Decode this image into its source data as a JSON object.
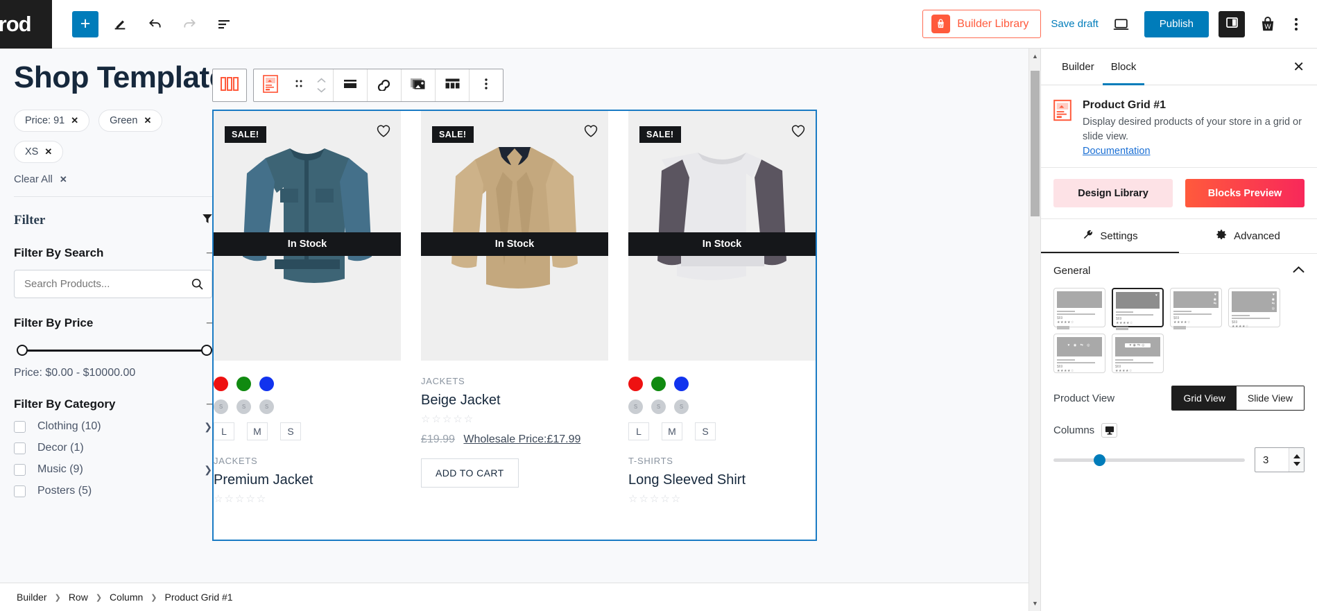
{
  "topbar": {
    "logo_text": "Prod",
    "add_label": "+",
    "icons": [
      "plus-icon",
      "pencil-icon",
      "undo-icon",
      "redo-icon",
      "list-view-icon"
    ],
    "builder_library_label": "Builder Library",
    "save_draft_label": "Save draft",
    "publish_label": "Publish",
    "view_icon": "desktop-preview-icon",
    "sidebar_toggle_icon": "settings-sidebar-icon",
    "bag_icon": "woo-bag-icon",
    "options_icon": "more-options-icon"
  },
  "canvas": {
    "page_title": "Shop Template",
    "chips": [
      {
        "label": "Price: 91"
      },
      {
        "label": "Green"
      },
      {
        "label": "XS"
      }
    ],
    "clear_all_label": "Clear All",
    "filter_heading": "Filter",
    "sections": {
      "search": {
        "title": "Filter By Search",
        "placeholder": "Search Products...",
        "value": ""
      },
      "price": {
        "title": "Filter By Price",
        "range_label": "Price: $0.00 - $10000.00",
        "min": "0.00",
        "max": "10000.00"
      },
      "category": {
        "title": "Filter By Category",
        "items": [
          {
            "label": "Clothing (10)",
            "has_children": true
          },
          {
            "label": "Decor (1)",
            "has_children": false
          },
          {
            "label": "Music (9)",
            "has_children": true
          },
          {
            "label": "Posters (5)",
            "has_children": false
          }
        ]
      }
    }
  },
  "block_toolbar": {
    "items": [
      "product-grid-block-icon",
      "transform-block-icon",
      "drag-handle-icon",
      "move-up-down-icon",
      "align-icon",
      "link-icon",
      "image-gallery-icon",
      "layout-grid-icon",
      "more-options-icon"
    ]
  },
  "products": [
    {
      "badge": "SALE!",
      "stock": "In Stock",
      "category": "JACKETS",
      "name": "Premium Jacket",
      "swatches": [
        "#ee1111",
        "#108a10",
        "#1133ee"
      ],
      "sizes": [
        "L",
        "M",
        "S"
      ],
      "price": "",
      "has_swatches": true
    },
    {
      "badge": "SALE!",
      "stock": "In Stock",
      "category": "JACKETS",
      "name": "Beige Jacket",
      "swatches": [],
      "sizes": [],
      "regular_price": "£19.99",
      "wholesale_price": "Wholesale Price:£17.99",
      "add_to_cart_label": "ADD TO CART",
      "has_swatches": false
    },
    {
      "badge": "SALE!",
      "stock": "In Stock",
      "category": "T-SHIRTS",
      "name": "Long Sleeved Shirt",
      "swatches": [
        "#ee1111",
        "#108a10",
        "#1133ee"
      ],
      "sizes": [
        "L",
        "M",
        "S"
      ],
      "price": "",
      "has_swatches": true
    }
  ],
  "right_panel": {
    "tabs": [
      {
        "label": "Builder",
        "active": false
      },
      {
        "label": "Block",
        "active": true
      }
    ],
    "close_icon": "close-icon",
    "block": {
      "icon": "product-grid-block-icon",
      "title": "Product Grid #1",
      "description": "Display desired products of your store in a grid or slide view.",
      "doc_link": "Documentation"
    },
    "design_library_label": "Design Library",
    "blocks_preview_label": "Blocks Preview",
    "settings_tab": "Settings",
    "advanced_tab": "Advanced",
    "general_label": "General",
    "layout_thumbs": [
      {
        "id": 1,
        "selected": false,
        "price": "$69",
        "stars": "★★★★☆"
      },
      {
        "id": 2,
        "selected": true,
        "price": "$69",
        "stars": "★★★★☆"
      },
      {
        "id": 3,
        "selected": false,
        "price": "$69",
        "stars": "★★★★☆"
      },
      {
        "id": 4,
        "selected": false,
        "price": "$69",
        "stars": "★★★★☆"
      },
      {
        "id": 5,
        "selected": false,
        "price": "$69",
        "stars": "★★★★☆"
      },
      {
        "id": 6,
        "selected": false,
        "price": "$69",
        "stars": "★★★★☆"
      }
    ],
    "product_view_label": "Product View",
    "grid_view_label": "Grid View",
    "slide_view_label": "Slide View",
    "columns_label": "Columns",
    "columns_value": "3",
    "device_icon": "desktop-icon"
  },
  "breadcrumb": {
    "items": [
      "Builder",
      "Row",
      "Column",
      "Product Grid #1"
    ]
  },
  "colors": {
    "accent_blue": "#007cba",
    "brand_orange": "#ff5a3c",
    "brand_pink": "#f8285a",
    "selection_blue": "#1a7bc4",
    "dark": "#15171a"
  }
}
